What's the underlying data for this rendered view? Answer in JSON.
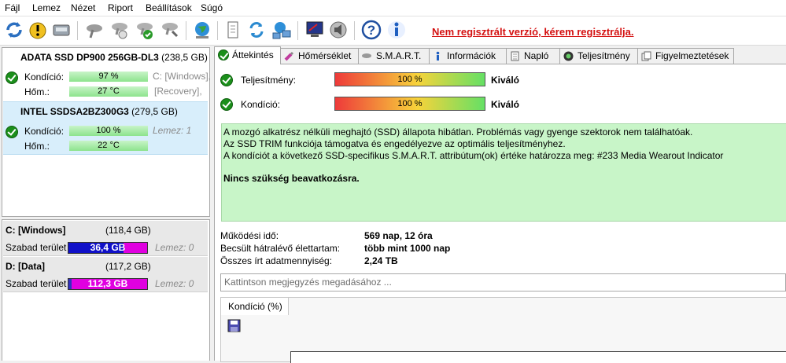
{
  "menu": [
    "Fájl",
    "Lemez",
    "Nézet",
    "Riport",
    "Beállítások",
    "Súgó"
  ],
  "toolbar": {
    "register_link": "Nem regisztrált verzió, kérem regisztrálja."
  },
  "disks": [
    {
      "name": "ADATA SSD DP900 256GB-DL3",
      "capacity": "(238,5 GB)",
      "condition_label": "Kondíció:",
      "condition": "97 %",
      "condition_level": 0.97,
      "temp_label": "Hőm.:",
      "temp": "27 °C",
      "part1": "C: [Windows],",
      "part2": "[Recovery],"
    },
    {
      "name": "INTEL SSDSA2BZ300G3",
      "capacity": "(279,5 GB)",
      "condition_label": "Kondíció:",
      "condition": "100 %",
      "condition_level": 1.0,
      "temp_label": "Hőm.:",
      "temp": "22 °C",
      "part1": "Lemez: 1"
    }
  ],
  "drives": [
    {
      "name": "C: [Windows]",
      "size": "(118,4 GB)",
      "free_label": "Szabad terület",
      "free": "36,4 GB",
      "free_fraction": 0.31,
      "disk": "Lemez: 0"
    },
    {
      "name": "D: [Data]",
      "size": "(117,2 GB)",
      "free_label": "Szabad terület",
      "free": "112,3 GB",
      "free_fraction": 0.96,
      "disk": "Lemez: 0"
    }
  ],
  "tabs": [
    "Áttekintés",
    "Hőmérséklet",
    "S.M.A.R.T.",
    "Információk",
    "Napló",
    "Teljesítmény",
    "Figyelmeztetések"
  ],
  "overview": {
    "performance_label": "Teljesítmény:",
    "performance_value": "100 %",
    "performance_level": 1.0,
    "performance_rating": "Kiváló",
    "condition_label": "Kondíció:",
    "condition_value": "100 %",
    "condition_level": 1.0,
    "condition_rating": "Kiváló",
    "desc1": "A mozgó alkatrész nélküli meghajtó (SSD) állapota hibátlan. Problémás vagy gyenge szektorok nem találhatóak.",
    "desc2": "Az SSD TRIM funkciója támogatva és engedélyezve az optimális teljesítményhez.",
    "desc3": "A kondíciót a következő SSD-specifikus S.M.A.R.T. attribútum(ok) értéke határozza meg:  #233 Media Wearout Indicator",
    "desc4": "Nincs szükség beavatkozásra.",
    "uptime_label": "Működési idő:",
    "uptime": "569 nap, 12 óra",
    "lifetime_label": "Becsült hátralévő élettartam:",
    "lifetime": "több mint 1000 nap",
    "written_label": "Összes írt adatmennyiség:",
    "written": "2,24 TB",
    "note_placeholder": "Kattintson megjegyzés megadásához ...",
    "subtab": "Kondíció  (%)"
  }
}
